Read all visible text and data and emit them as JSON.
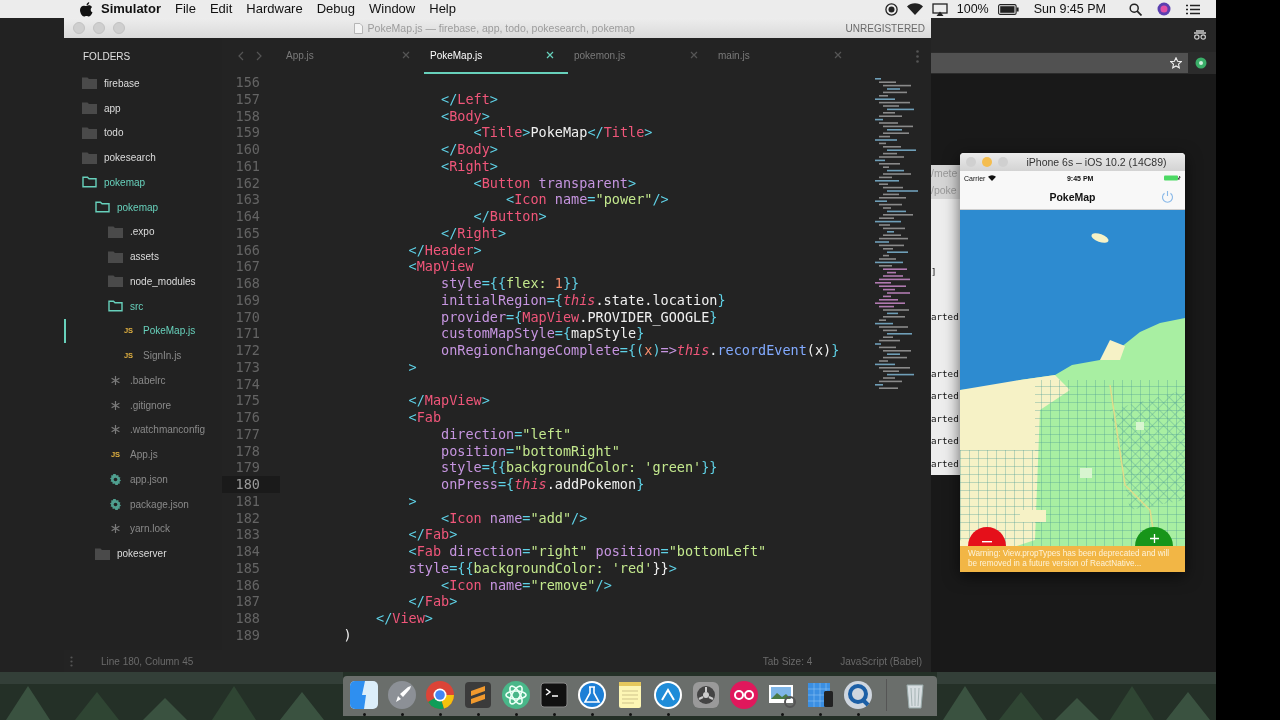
{
  "menubar": {
    "app": "Simulator",
    "menus": [
      "File",
      "Edit",
      "Hardware",
      "Debug",
      "Window",
      "Help"
    ],
    "battery": "100%",
    "clock": "Sun 9:45 PM"
  },
  "editor": {
    "title": "PokeMap.js — firebase, app, todo, pokesearch, pokemap",
    "license": "UNREGISTERED",
    "sidebar_heading": "FOLDERS",
    "tree": [
      {
        "name": "firebase",
        "kind": "folder",
        "expanded": false,
        "selected": false
      },
      {
        "name": "app",
        "kind": "folder",
        "expanded": false,
        "selected": false
      },
      {
        "name": "todo",
        "kind": "folder",
        "expanded": false,
        "selected": false
      },
      {
        "name": "pokesearch",
        "kind": "folder",
        "expanded": false,
        "selected": false
      },
      {
        "name": "pokemap",
        "kind": "folder",
        "expanded": true,
        "selected": false,
        "children": [
          {
            "name": "pokemap",
            "kind": "folder",
            "expanded": true,
            "selected": false,
            "children": [
              {
                "name": ".expo",
                "kind": "folder",
                "expanded": false,
                "selected": false
              },
              {
                "name": "assets",
                "kind": "folder",
                "expanded": false,
                "selected": false
              },
              {
                "name": "node_modules",
                "kind": "folder",
                "expanded": false,
                "selected": false
              },
              {
                "name": "src",
                "kind": "folder",
                "expanded": true,
                "selected": false,
                "children": [
                  {
                    "name": "PokeMap.js",
                    "kind": "script",
                    "badge": "JS",
                    "selected": true
                  },
                  {
                    "name": "SignIn.js",
                    "kind": "script",
                    "badge": "JS",
                    "selected": false
                  }
                ]
              },
              {
                "name": ".babelrc",
                "kind": "plain",
                "selected": false
              },
              {
                "name": ".gitignore",
                "kind": "plain",
                "selected": false
              },
              {
                "name": ".watchmanconfig",
                "kind": "plain",
                "selected": false
              },
              {
                "name": "App.js",
                "kind": "script",
                "badge": "JS",
                "selected": false
              },
              {
                "name": "app.json",
                "kind": "config",
                "selected": false
              },
              {
                "name": "package.json",
                "kind": "config",
                "selected": false
              },
              {
                "name": "yarn.lock",
                "kind": "plain",
                "selected": false
              }
            ]
          },
          {
            "name": "pokeserver",
            "kind": "folder",
            "expanded": false,
            "selected": false
          }
        ]
      }
    ],
    "tabs": [
      {
        "label": "App.js",
        "selected": false
      },
      {
        "label": "PokeMap.js",
        "selected": true
      },
      {
        "label": "pokemon.js",
        "selected": false
      },
      {
        "label": "main.js",
        "selected": false
      }
    ],
    "lines": [
      {
        "number": "156",
        "current": false
      },
      {
        "number": "157",
        "current": false,
        "tokens": [
          {
            "kind": "punct",
            "text": "                </"
          },
          {
            "kind": "tag",
            "text": "Left"
          },
          {
            "kind": "punct",
            "text": ">"
          }
        ]
      },
      {
        "number": "158",
        "current": false,
        "tokens": [
          {
            "kind": "punct",
            "text": "                <"
          },
          {
            "kind": "tag",
            "text": "Body"
          },
          {
            "kind": "punct",
            "text": ">"
          }
        ]
      },
      {
        "number": "159",
        "current": false,
        "tokens": [
          {
            "kind": "punct",
            "text": "                    <"
          },
          {
            "kind": "tag",
            "text": "Title"
          },
          {
            "kind": "punct",
            "text": ">"
          },
          {
            "kind": "plain",
            "text": "PokeMap"
          },
          {
            "kind": "punct",
            "text": "</"
          },
          {
            "kind": "tag",
            "text": "Title"
          },
          {
            "kind": "punct",
            "text": ">"
          }
        ]
      },
      {
        "number": "160",
        "current": false,
        "tokens": [
          {
            "kind": "punct",
            "text": "                </"
          },
          {
            "kind": "tag",
            "text": "Body"
          },
          {
            "kind": "punct",
            "text": ">"
          }
        ]
      },
      {
        "number": "161",
        "current": false,
        "tokens": [
          {
            "kind": "punct",
            "text": "                <"
          },
          {
            "kind": "tag",
            "text": "Right"
          },
          {
            "kind": "punct",
            "text": ">"
          }
        ]
      },
      {
        "number": "162",
        "current": false,
        "tokens": [
          {
            "kind": "punct",
            "text": "                    <"
          },
          {
            "kind": "tag",
            "text": "Button"
          },
          {
            "kind": "attr",
            "text": " transparent"
          },
          {
            "kind": "punct",
            "text": ">"
          }
        ]
      },
      {
        "number": "163",
        "current": false,
        "tokens": [
          {
            "kind": "punct",
            "text": "                        <"
          },
          {
            "kind": "tag",
            "text": "Icon"
          },
          {
            "kind": "attr",
            "text": " name"
          },
          {
            "kind": "punct",
            "text": "="
          },
          {
            "kind": "string",
            "text": "\"power\""
          },
          {
            "kind": "punct",
            "text": "/>"
          }
        ]
      },
      {
        "number": "164",
        "current": false,
        "tokens": [
          {
            "kind": "punct",
            "text": "                    </"
          },
          {
            "kind": "tag",
            "text": "Button"
          },
          {
            "kind": "punct",
            "text": ">"
          }
        ]
      },
      {
        "number": "165",
        "current": false,
        "tokens": [
          {
            "kind": "punct",
            "text": "                </"
          },
          {
            "kind": "tag",
            "text": "Right"
          },
          {
            "kind": "punct",
            "text": ">"
          }
        ]
      },
      {
        "number": "166",
        "current": false,
        "tokens": [
          {
            "kind": "punct",
            "text": "            </"
          },
          {
            "kind": "tag",
            "text": "Header"
          },
          {
            "kind": "punct",
            "text": ">"
          }
        ]
      },
      {
        "number": "167",
        "current": false,
        "tokens": [
          {
            "kind": "punct",
            "text": "            <"
          },
          {
            "kind": "tag",
            "text": "MapView"
          }
        ]
      },
      {
        "number": "168",
        "current": false,
        "tokens": [
          {
            "kind": "attr",
            "text": "                style"
          },
          {
            "kind": "punct",
            "text": "={{"
          },
          {
            "kind": "string",
            "text": "flex:"
          },
          {
            "kind": "number",
            "text": " 1"
          },
          {
            "kind": "punct",
            "text": "}}"
          }
        ]
      },
      {
        "number": "169",
        "current": false,
        "tokens": [
          {
            "kind": "attr",
            "text": "                initialRegion"
          },
          {
            "kind": "punct",
            "text": "={"
          },
          {
            "kind": "keyword",
            "text": "this"
          },
          {
            "kind": "plain",
            "text": ".state.location"
          },
          {
            "kind": "punct",
            "text": "}"
          }
        ]
      },
      {
        "number": "170",
        "current": false,
        "tokens": [
          {
            "kind": "attr",
            "text": "                provider"
          },
          {
            "kind": "punct",
            "text": "={"
          },
          {
            "kind": "tag",
            "text": "MapView"
          },
          {
            "kind": "plain",
            "text": ".PROVIDER_GOOGLE"
          },
          {
            "kind": "punct",
            "text": "}"
          }
        ]
      },
      {
        "number": "171",
        "current": false,
        "tokens": [
          {
            "kind": "attr",
            "text": "                customMapStyle"
          },
          {
            "kind": "punct",
            "text": "={"
          },
          {
            "kind": "plain",
            "text": "mapStyle"
          },
          {
            "kind": "punct",
            "text": "}"
          }
        ]
      },
      {
        "number": "172",
        "current": false,
        "tokens": [
          {
            "kind": "attr",
            "text": "                onRegionChangeComplete"
          },
          {
            "kind": "punct",
            "text": "={("
          },
          {
            "kind": "number",
            "text": "x"
          },
          {
            "kind": "punct",
            "text": ")"
          },
          {
            "kind": "attr",
            "text": "=>"
          },
          {
            "kind": "keyword",
            "text": "this"
          },
          {
            "kind": "plain",
            "text": "."
          },
          {
            "kind": "func",
            "text": "recordEvent"
          },
          {
            "kind": "plain",
            "text": "(x)"
          },
          {
            "kind": "punct",
            "text": "}"
          }
        ]
      },
      {
        "number": "173",
        "current": false,
        "tokens": [
          {
            "kind": "punct",
            "text": "            >"
          }
        ]
      },
      {
        "number": "174",
        "current": false
      },
      {
        "number": "175",
        "current": false,
        "tokens": [
          {
            "kind": "punct",
            "text": "            </"
          },
          {
            "kind": "tag",
            "text": "MapView"
          },
          {
            "kind": "punct",
            "text": ">"
          }
        ]
      },
      {
        "number": "176",
        "current": false,
        "tokens": [
          {
            "kind": "punct",
            "text": "            <"
          },
          {
            "kind": "tag",
            "text": "Fab"
          }
        ]
      },
      {
        "number": "177",
        "current": false,
        "tokens": [
          {
            "kind": "attr",
            "text": "                direction"
          },
          {
            "kind": "punct",
            "text": "="
          },
          {
            "kind": "string",
            "text": "\"left\""
          }
        ]
      },
      {
        "number": "178",
        "current": false,
        "tokens": [
          {
            "kind": "attr",
            "text": "                position"
          },
          {
            "kind": "punct",
            "text": "="
          },
          {
            "kind": "string",
            "text": "\"bottomRight\""
          }
        ]
      },
      {
        "number": "179",
        "current": false,
        "tokens": [
          {
            "kind": "attr",
            "text": "                style"
          },
          {
            "kind": "punct",
            "text": "={{"
          },
          {
            "kind": "string",
            "text": "backgroundColor: 'green'"
          },
          {
            "kind": "punct",
            "text": "}}"
          }
        ]
      },
      {
        "number": "180",
        "current": true,
        "tokens": [
          {
            "kind": "attr",
            "text": "                onPress"
          },
          {
            "kind": "punct",
            "text": "={"
          },
          {
            "kind": "keyword",
            "text": "this"
          },
          {
            "kind": "plain",
            "text": ".addPokemon"
          },
          {
            "kind": "punct",
            "text": "}"
          }
        ]
      },
      {
        "number": "181",
        "current": false,
        "tokens": [
          {
            "kind": "punct",
            "text": "            >"
          }
        ]
      },
      {
        "number": "182",
        "current": false,
        "tokens": [
          {
            "kind": "punct",
            "text": "                <"
          },
          {
            "kind": "tag",
            "text": "Icon"
          },
          {
            "kind": "attr",
            "text": " name"
          },
          {
            "kind": "punct",
            "text": "="
          },
          {
            "kind": "string",
            "text": "\"add\""
          },
          {
            "kind": "punct",
            "text": "/>"
          }
        ]
      },
      {
        "number": "183",
        "current": false,
        "tokens": [
          {
            "kind": "punct",
            "text": "            </"
          },
          {
            "kind": "tag",
            "text": "Fab"
          },
          {
            "kind": "punct",
            "text": ">"
          }
        ]
      },
      {
        "number": "184",
        "current": false,
        "tokens": [
          {
            "kind": "punct",
            "text": "            <"
          },
          {
            "kind": "tag",
            "text": "Fab"
          },
          {
            "kind": "attr",
            "text": " direction"
          },
          {
            "kind": "punct",
            "text": "="
          },
          {
            "kind": "string",
            "text": "\"right\""
          },
          {
            "kind": "attr",
            "text": " position"
          },
          {
            "kind": "punct",
            "text": "="
          },
          {
            "kind": "string",
            "text": "\"bottomLeft\""
          }
        ]
      },
      {
        "number": "185",
        "current": false,
        "tokens": [
          {
            "kind": "attr",
            "text": "            style"
          },
          {
            "kind": "punct",
            "text": "={{"
          },
          {
            "kind": "string",
            "text": "backgroundColor: 'red'"
          },
          {
            "kind": "plain",
            "text": "}}"
          },
          {
            "kind": "punct",
            "text": ">"
          }
        ]
      },
      {
        "number": "186",
        "current": false,
        "tokens": [
          {
            "kind": "punct",
            "text": "                <"
          },
          {
            "kind": "tag",
            "text": "Icon"
          },
          {
            "kind": "attr",
            "text": " name"
          },
          {
            "kind": "punct",
            "text": "="
          },
          {
            "kind": "string",
            "text": "\"remove\""
          },
          {
            "kind": "punct",
            "text": "/>"
          }
        ]
      },
      {
        "number": "187",
        "current": false,
        "tokens": [
          {
            "kind": "punct",
            "text": "            </"
          },
          {
            "kind": "tag",
            "text": "Fab"
          },
          {
            "kind": "punct",
            "text": ">"
          }
        ]
      },
      {
        "number": "188",
        "current": false,
        "tokens": [
          {
            "kind": "punct",
            "text": "        </"
          },
          {
            "kind": "tag",
            "text": "View"
          },
          {
            "kind": "punct",
            "text": ">"
          }
        ]
      },
      {
        "number": "189",
        "current": false,
        "tokens": [
          {
            "kind": "plain",
            "text": "    )"
          }
        ]
      }
    ],
    "status": {
      "position": "Line 180, Column 45",
      "tab_size": "Tab Size: 4",
      "syntax": "JavaScript (Babel)"
    }
  },
  "terminal": {
    "title": "/mete",
    "tab": "/poke",
    "lines": [
      "]",
      "arted",
      "arted",
      "arted",
      "arted",
      "arted",
      "arted"
    ]
  },
  "simulator": {
    "title": "iPhone 6s – iOS 10.2 (14C89)",
    "carrier": "Carrier",
    "time": "9:45 PM",
    "nav_title": "PokeMap",
    "warning": "Warning: View.propTypes has been deprecated and will be removed in a future version of ReactNative..."
  },
  "dock": [
    {
      "kind": "split",
      "running": true
    },
    {
      "kind": "rocket",
      "running": true
    },
    {
      "kind": "rings",
      "running": true
    },
    {
      "kind": "editor",
      "running": true
    },
    {
      "kind": "atom",
      "running": true
    },
    {
      "kind": "terminal",
      "running": true
    },
    {
      "kind": "flask",
      "running": true
    },
    {
      "kind": "notepad",
      "running": true
    },
    {
      "kind": "caret",
      "running": true
    },
    {
      "kind": "gear",
      "running": false
    },
    {
      "kind": "dots",
      "running": false
    },
    {
      "kind": "photos",
      "running": true
    },
    {
      "kind": "blueprint",
      "running": true
    },
    {
      "kind": "magnifier",
      "running": true
    },
    {
      "kind": "trash",
      "running": false
    }
  ]
}
